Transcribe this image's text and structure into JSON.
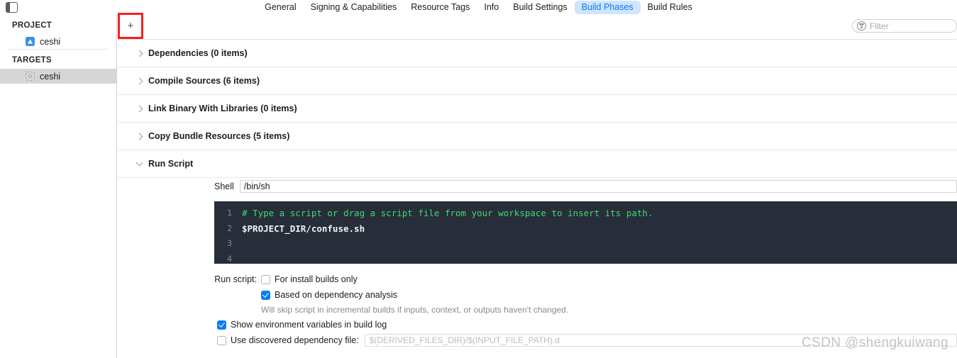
{
  "topbar": {
    "sidebar_toggle_name": "sidebar-toggle-icon",
    "tabs": [
      {
        "label": "General",
        "selected": false
      },
      {
        "label": "Signing & Capabilities",
        "selected": false
      },
      {
        "label": "Resource Tags",
        "selected": false
      },
      {
        "label": "Info",
        "selected": false
      },
      {
        "label": "Build Settings",
        "selected": false
      },
      {
        "label": "Build Phases",
        "selected": true
      },
      {
        "label": "Build Rules",
        "selected": false
      }
    ],
    "selected_tab": "Build Phases",
    "selected_tab_color": "#0a7cf5",
    "selected_tab_bg": "#cfe5fd"
  },
  "sidebar": {
    "project_section_title": "PROJECT",
    "project_items": [
      {
        "label": "ceshi",
        "icon": "xcode-project-icon",
        "selected": false
      }
    ],
    "targets_section_title": "TARGETS",
    "target_items": [
      {
        "label": "ceshi",
        "icon": "app-target-icon",
        "selected": true
      }
    ]
  },
  "toolbar": {
    "add_label": "+",
    "add_highlight_color": "#f32020",
    "filter_placeholder": "Filter",
    "filter_icon": "filter-icon"
  },
  "phases": [
    {
      "title": "Dependencies (0 items)",
      "expanded": false
    },
    {
      "title": "Compile Sources (6 items)",
      "expanded": false
    },
    {
      "title": "Link Binary With Libraries (0 items)",
      "expanded": false
    },
    {
      "title": "Copy Bundle Resources (5 items)",
      "expanded": false
    },
    {
      "title": "Run Script",
      "expanded": true
    }
  ],
  "run_script": {
    "shell_label": "Shell",
    "shell_value": "/bin/sh",
    "editor": {
      "line_numbers": [
        "1",
        "2",
        "3",
        "4"
      ],
      "lines": [
        {
          "text": "# Type a script or drag a script file from your workspace to insert its path.",
          "kind": "comment"
        },
        {
          "text": "$PROJECT_DIR/confuse.sh",
          "kind": "command"
        },
        {
          "text": "",
          "kind": "plain"
        },
        {
          "text": "",
          "kind": "plain"
        }
      ],
      "comment_color": "#41d96f",
      "command_color": "#f2f2f5",
      "background_color": "#272d39",
      "gutter_color": "#838a96"
    },
    "run_script_label": "Run script:",
    "options": [
      {
        "label": "For install builds only",
        "checked": false
      },
      {
        "label": "Based on dependency analysis",
        "checked": true
      }
    ],
    "dependency_hint": "Will skip script in incremental builds if inputs, context, or outputs haven't changed.",
    "show_env_label": "Show environment variables in build log",
    "show_env_checked": true,
    "use_dep_file_label": "Use discovered dependency file:",
    "use_dep_file_checked": false,
    "use_dep_file_placeholder": "$(DERIVED_FILES_DIR)/$(INPUT_FILE_PATH).d"
  },
  "watermark": {
    "text": "CSDN @shengkuiwang"
  }
}
